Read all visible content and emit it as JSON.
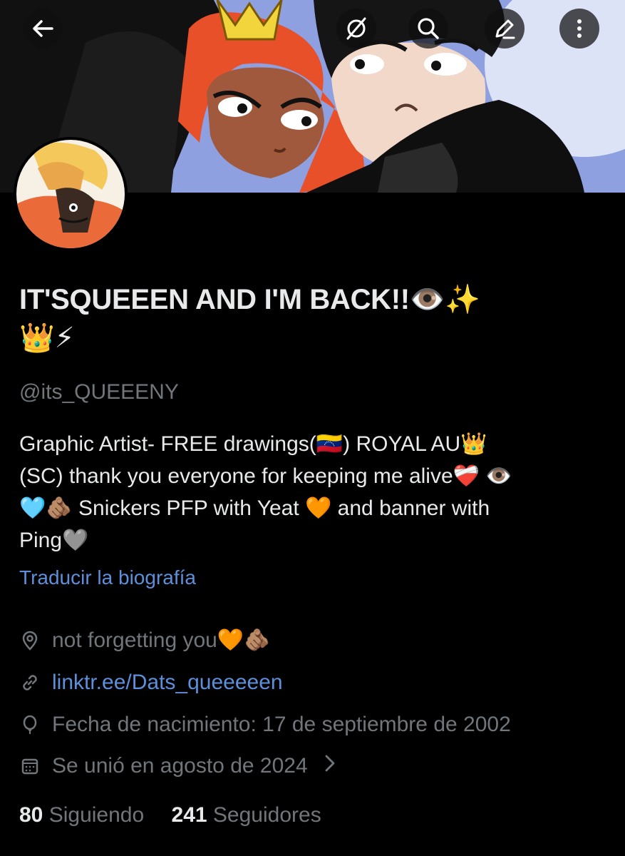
{
  "header": {
    "back_icon": "arrow-left-icon",
    "actions": [
      "grok-icon",
      "search-icon",
      "edit-icon",
      "more-vertical-icon"
    ]
  },
  "profile": {
    "display_name_line1": "IT'SQUEEEN AND I'M BACK!!👁️✨",
    "display_name_line2": "👑⚡",
    "handle": "@its_QUEEENY",
    "bio_lines": [
      "Graphic Artist-  FREE drawings(🇻🇪) ROYAL AU👑",
      "(SC) thank you everyone for keeping me alive❤️‍🩹 👁️",
      "🩵🫵🏽 Snickers PFP with Yeat 🧡 and banner with",
      "Ping🩶"
    ],
    "translate_label": "Traducir la biografía",
    "location": "not forgetting you🧡🫵🏽",
    "website": "linktr.ee/Dats_queeeeen",
    "birthday": "Fecha de nacimiento: 17 de septiembre de 2002",
    "joined": "Se unió en agosto de 2024",
    "following_count": "80",
    "following_label": "Siguiendo",
    "followers_count": "241",
    "followers_label": "Seguidores"
  },
  "colors": {
    "background": "#000000",
    "text": "#e7e9ea",
    "muted": "#71767b",
    "link": "#5d8fdb"
  }
}
